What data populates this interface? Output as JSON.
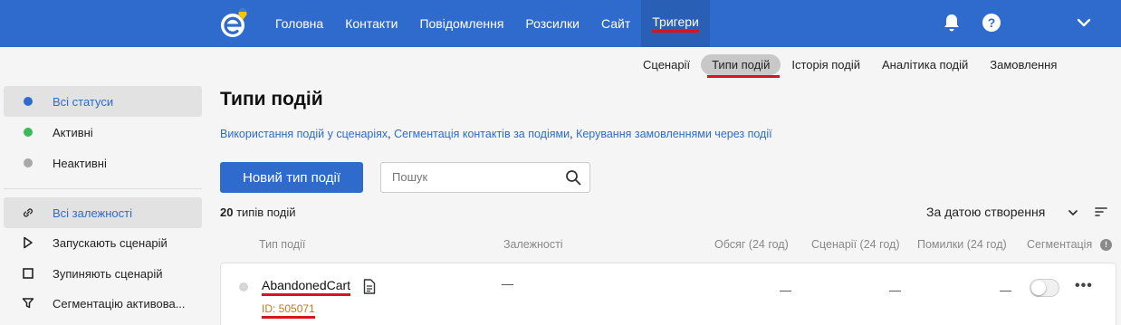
{
  "header": {
    "nav": [
      "Головна",
      "Контакти",
      "Повідомлення",
      "Розсилки",
      "Сайт",
      "Тригери"
    ],
    "active_nav": "Тригери",
    "help_label": "?"
  },
  "subnav": {
    "items": [
      "Сценарії",
      "Типи подій",
      "Історія подій",
      "Аналітика подій",
      "Замовлення"
    ],
    "active": "Типи подій"
  },
  "sidebar": {
    "status_items": [
      {
        "label": "Всі статуси",
        "dot_color": "#2f6bcc"
      },
      {
        "label": "Активні",
        "dot_color": "#3cb95a"
      },
      {
        "label": "Неактивні",
        "dot_color": "#a8a8a8"
      }
    ],
    "dependency_items": [
      {
        "label": "Всі залежності",
        "icon": "link-icon"
      },
      {
        "label": "Запускають сценарій",
        "icon": "play-icon"
      },
      {
        "label": "Зупиняють сценарій",
        "icon": "stop-icon"
      },
      {
        "label": "Сегментацію активова...",
        "icon": "filter-icon"
      }
    ]
  },
  "main": {
    "title": "Типи подій",
    "links": [
      "Використання подій у сценаріях",
      "Сегментація контактів за подіями",
      "Керування замовленнями через події"
    ],
    "link_separator": ",",
    "new_button": "Новий тип події",
    "search_placeholder": "Пошук",
    "count_number": "20",
    "count_label": "типів подій",
    "sort_label": "За датою створення",
    "columns": [
      "Тип події",
      "Залежності",
      "Обсяг (24 год)",
      "Сценарії (24 год)",
      "Помилки (24 год)",
      "Сегментація"
    ],
    "rows": [
      {
        "name": "AbandonedCart",
        "id": "ID: 505071",
        "dependencies": "—",
        "volume": "—",
        "scenarios": "—",
        "errors": "—",
        "segmentation": false,
        "more": "•••"
      }
    ]
  },
  "colors": {
    "accent": "#2f6bcc",
    "highlight_underline": "#d8141c",
    "active_status": "#3cb95a"
  }
}
